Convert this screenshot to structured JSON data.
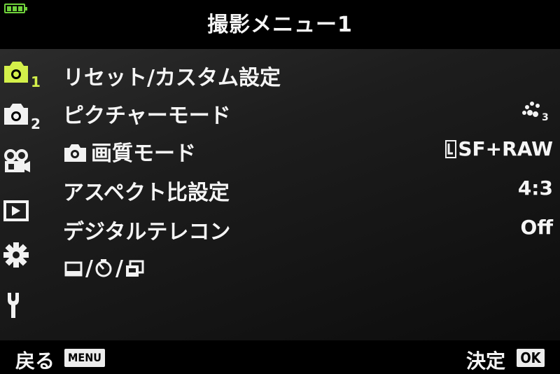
{
  "header": {
    "title": "撮影メニュー1"
  },
  "tabs": [
    {
      "name": "shooting-menu-1",
      "number": "1",
      "color": "#d4f04a",
      "selected": true
    },
    {
      "name": "shooting-menu-2",
      "number": "2",
      "color": "#f2f2f2",
      "selected": false
    },
    {
      "name": "video-menu",
      "color": "#f2f2f2",
      "selected": false
    },
    {
      "name": "playback-menu",
      "color": "#f2f2f2",
      "selected": false
    },
    {
      "name": "custom-menu",
      "color": "#f2f2f2",
      "selected": false
    },
    {
      "name": "setup-menu",
      "color": "#f2f2f2",
      "selected": false
    }
  ],
  "menu": {
    "items": [
      {
        "label": "リセット/カスタム設定",
        "value": ""
      },
      {
        "label": "ピクチャーモード",
        "value": "",
        "value_icon": "picture-mode-3-icon"
      },
      {
        "label": "画質モード",
        "label_icon": "camera-icon",
        "value": "SF+RAW",
        "value_icon": "large-size-icon"
      },
      {
        "label": "アスペクト比設定",
        "value": "4:3"
      },
      {
        "label": "デジタルテレコン",
        "value": "Off"
      },
      {
        "label": "//",
        "label_icons": [
          "single-drive-icon",
          "self-timer-icon",
          "sequential-drive-icon"
        ],
        "value": ""
      }
    ]
  },
  "footer": {
    "back_label": "戻る",
    "menu_key": "MENU",
    "confirm_label": "決定",
    "ok_key": "OK"
  },
  "colors": {
    "selected_tab": "#d4f04a",
    "battery": "#6fd23b",
    "text": "#f5f5f5"
  }
}
